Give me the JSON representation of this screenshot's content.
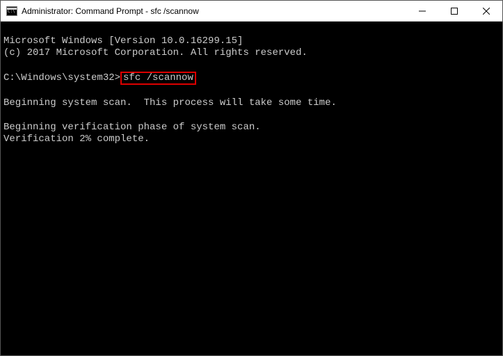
{
  "window": {
    "title": "Administrator: Command Prompt - sfc  /scannow"
  },
  "terminal": {
    "line1": "Microsoft Windows [Version 10.0.16299.15]",
    "line2": "(c) 2017 Microsoft Corporation. All rights reserved.",
    "prompt_path": "C:\\Windows\\system32>",
    "command": "sfc /scannow",
    "msg_begin_scan": "Beginning system scan.  This process will take some time.",
    "msg_verify_phase": "Beginning verification phase of system scan.",
    "msg_progress": "Verification 2% complete."
  }
}
